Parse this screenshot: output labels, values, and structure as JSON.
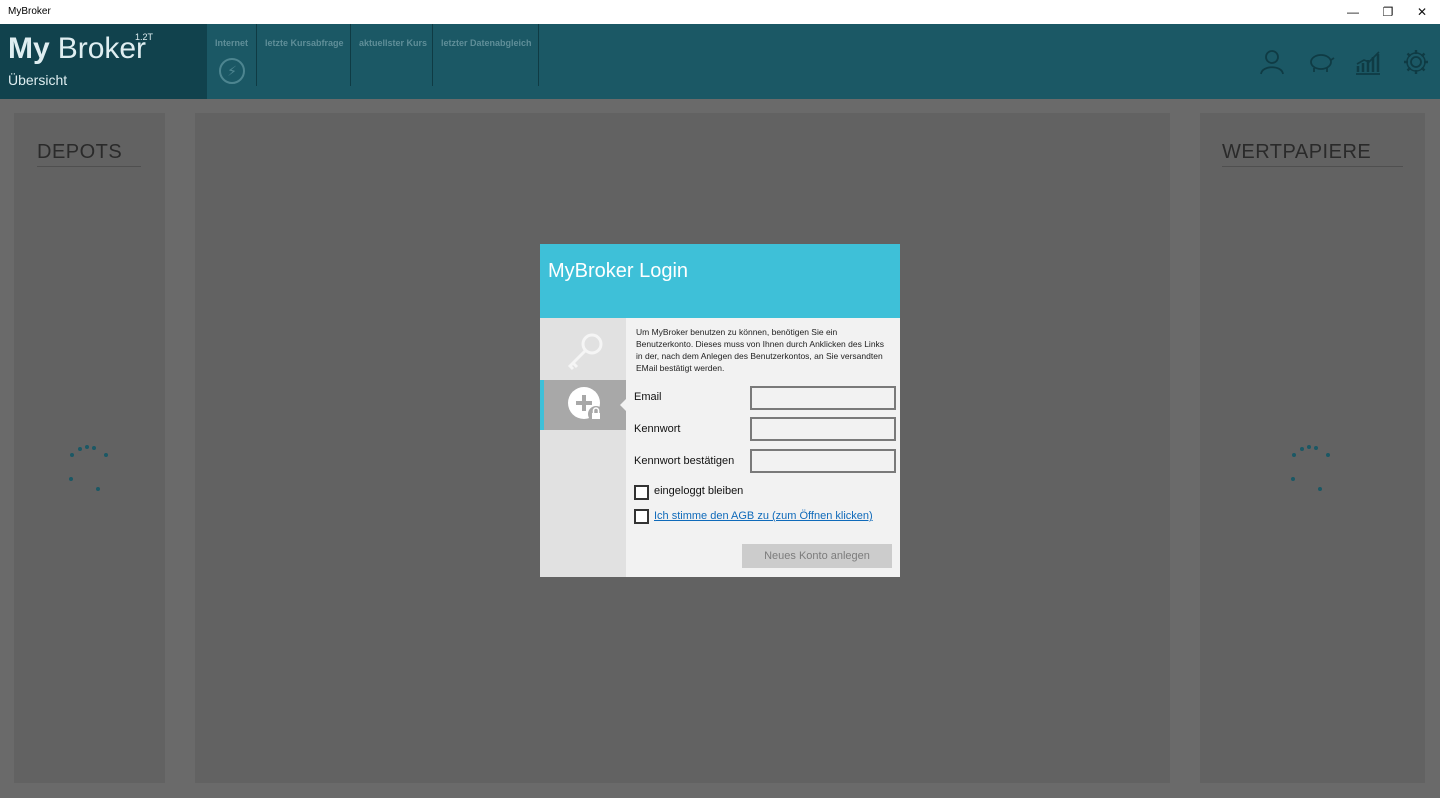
{
  "window": {
    "title": "MyBroker",
    "controls": {
      "minimize": "—",
      "restore": "❐",
      "close": "✕"
    }
  },
  "header": {
    "brand_bold": "My",
    "brand_light": "Broker",
    "version": "1.2T",
    "page_name": "Übersicht",
    "status": [
      {
        "label": "Internet"
      },
      {
        "label": "letzte Kursabfrage"
      },
      {
        "label": "aktuellster Kurs"
      },
      {
        "label": "letzter Datenabgleich"
      }
    ],
    "icons": [
      "user-icon",
      "piggy-bank-icon",
      "chart-icon",
      "settings-gear-icon"
    ]
  },
  "panels": {
    "left_title": "DEPOTS",
    "right_title": "WERTPAPIERE"
  },
  "dialog": {
    "title": "MyBroker Login",
    "intro": "Um MyBroker benutzen zu können, benötigen Sie ein Benutzerkonto. Dieses muss von Ihnen durch Anklicken des Links in der, nach dem Anlegen des Benutzerkontos, an Sie versandten EMail bestätigt werden.",
    "fields": {
      "email_label": "Email",
      "email_value": "",
      "password_label": "Kennwort",
      "password_value": "",
      "confirm_label": "Kennwort bestätigen",
      "confirm_value": ""
    },
    "stay_logged_in": "eingeloggt bleiben",
    "agb": "Ich stimme den AGB zu (zum Öffnen klicken)",
    "submit": "Neues Konto anlegen"
  },
  "colors": {
    "header": "#1b5865",
    "brand": "#11424d",
    "dialog_accent": "#3ec0d8",
    "overlay": "#6a6a6a",
    "link": "#0f6aba"
  }
}
